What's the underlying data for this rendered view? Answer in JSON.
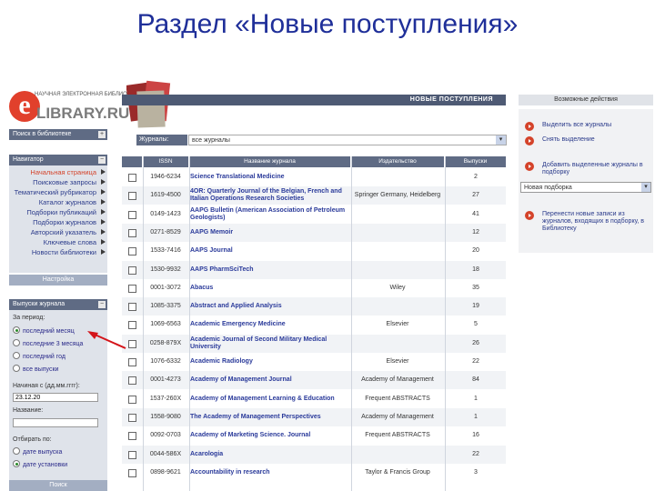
{
  "slide_title": "Раздел «Новые поступления»",
  "logo": {
    "line1": "НАУЧНАЯ ЭЛЕКТРОННАЯ",
    "line1b": "БИБЛИОТЕКА",
    "brand": "LIBRARY.RU",
    "letter": "e"
  },
  "sidebar": {
    "search_header": "Поиск в библиотеке",
    "navigator_header": "Навигатор",
    "nav_items": [
      {
        "label": "Начальная страница",
        "current": true
      },
      {
        "label": "Поисковые запросы",
        "current": false
      },
      {
        "label": "Тематический рубрикатор",
        "current": false
      },
      {
        "label": "Каталог журналов",
        "current": false
      },
      {
        "label": "Подборки публикаций",
        "current": false
      },
      {
        "label": "Подборки журналов",
        "current": false
      },
      {
        "label": "Авторский указатель",
        "current": false
      },
      {
        "label": "Ключевые слова",
        "current": false
      },
      {
        "label": "Новости библиотеки",
        "current": false
      }
    ],
    "settings_label": "Настройка",
    "issue_header": "Выпуски журнала",
    "period_label": "За период:",
    "periods": [
      {
        "label": "последний месяц",
        "checked": true
      },
      {
        "label": "последние 3 месяца",
        "checked": false
      },
      {
        "label": "последний год",
        "checked": false
      },
      {
        "label": "все выпуски",
        "checked": false
      }
    ],
    "start_label": "Начиная с (дд.мм.гггг):",
    "start_value": "23.12.20",
    "journal_label": "Название:",
    "sort_label": "Отбирать по:",
    "sort_options": [
      {
        "label": "дате выпуска",
        "checked": false
      },
      {
        "label": "дате установки",
        "checked": true
      }
    ],
    "search_button": "Поиск"
  },
  "main": {
    "header": "НОВЫЕ ПОСТУПЛЕНИЯ",
    "filter_label": "Журналы:",
    "filter_value": "все журналы",
    "columns": [
      "",
      "ISSN",
      "Название журнала",
      "Издательство",
      "Выпуски"
    ],
    "rows": [
      {
        "issn": "1946-6234",
        "title": "Science Translational Medicine",
        "publisher": "",
        "issues": "2"
      },
      {
        "issn": "1619-4500",
        "title": "4OR: Quarterly Journal of the Belgian, French and Italian Operations Research Societies",
        "publisher": "Springer Germany, Heidelberg",
        "issues": "27"
      },
      {
        "issn": "0149-1423",
        "title": "AAPG Bulletin (American Association of Petroleum Geologists)",
        "publisher": "",
        "issues": "41"
      },
      {
        "issn": "0271-8529",
        "title": "AAPG Memoir",
        "publisher": "",
        "issues": "12"
      },
      {
        "issn": "1533-7416",
        "title": "AAPS Journal",
        "publisher": "",
        "issues": "20"
      },
      {
        "issn": "1530-9932",
        "title": "AAPS PharmSciTech",
        "publisher": "",
        "issues": "18"
      },
      {
        "issn": "0001-3072",
        "title": "Abacus",
        "publisher": "Wiley",
        "issues": "35"
      },
      {
        "issn": "1085-3375",
        "title": "Abstract and Applied Analysis",
        "publisher": "",
        "issues": "19"
      },
      {
        "issn": "1069-6563",
        "title": "Academic Emergency Medicine",
        "publisher": "Elsevier",
        "issues": "5"
      },
      {
        "issn": "0258-879X",
        "title": "Academic Journal of Second Military Medical University",
        "publisher": "",
        "issues": "26"
      },
      {
        "issn": "1076-6332",
        "title": "Academic Radiology",
        "publisher": "Elsevier",
        "issues": "22"
      },
      {
        "issn": "0001-4273",
        "title": "Academy of Management Journal",
        "publisher": "Academy of Management",
        "issues": "84"
      },
      {
        "issn": "1537-260X",
        "title": "Academy of Management Learning & Education",
        "publisher": "Frequent ABSTRACTS",
        "issues": "1"
      },
      {
        "issn": "1558-9080",
        "title": "The Academy of Management Perspectives",
        "publisher": "Academy of Management",
        "issues": "1"
      },
      {
        "issn": "0092-0703",
        "title": "Academy of Marketing Science. Journal",
        "publisher": "Frequent ABSTRACTS",
        "issues": "16"
      },
      {
        "issn": "0044-586X",
        "title": "Acarologia",
        "publisher": "",
        "issues": "22"
      },
      {
        "issn": "0898-9621",
        "title": "Accountability in research",
        "publisher": "Taylor & Francis Group",
        "issues": "3"
      }
    ]
  },
  "right_panel": {
    "header": "Возможные действия",
    "actions": [
      "Выделить все журналы",
      "Снять выделение",
      "Добавить выделенные журналы в подборку",
      "Перенести новые записи из журналов, входящих в подборку, в Библиотеку"
    ],
    "select_value": "Новая подборка"
  },
  "colors": {
    "title": "#1f2f99",
    "accent": "#d4432a",
    "header": "#5f6b84",
    "link": "#2a3a9a"
  }
}
